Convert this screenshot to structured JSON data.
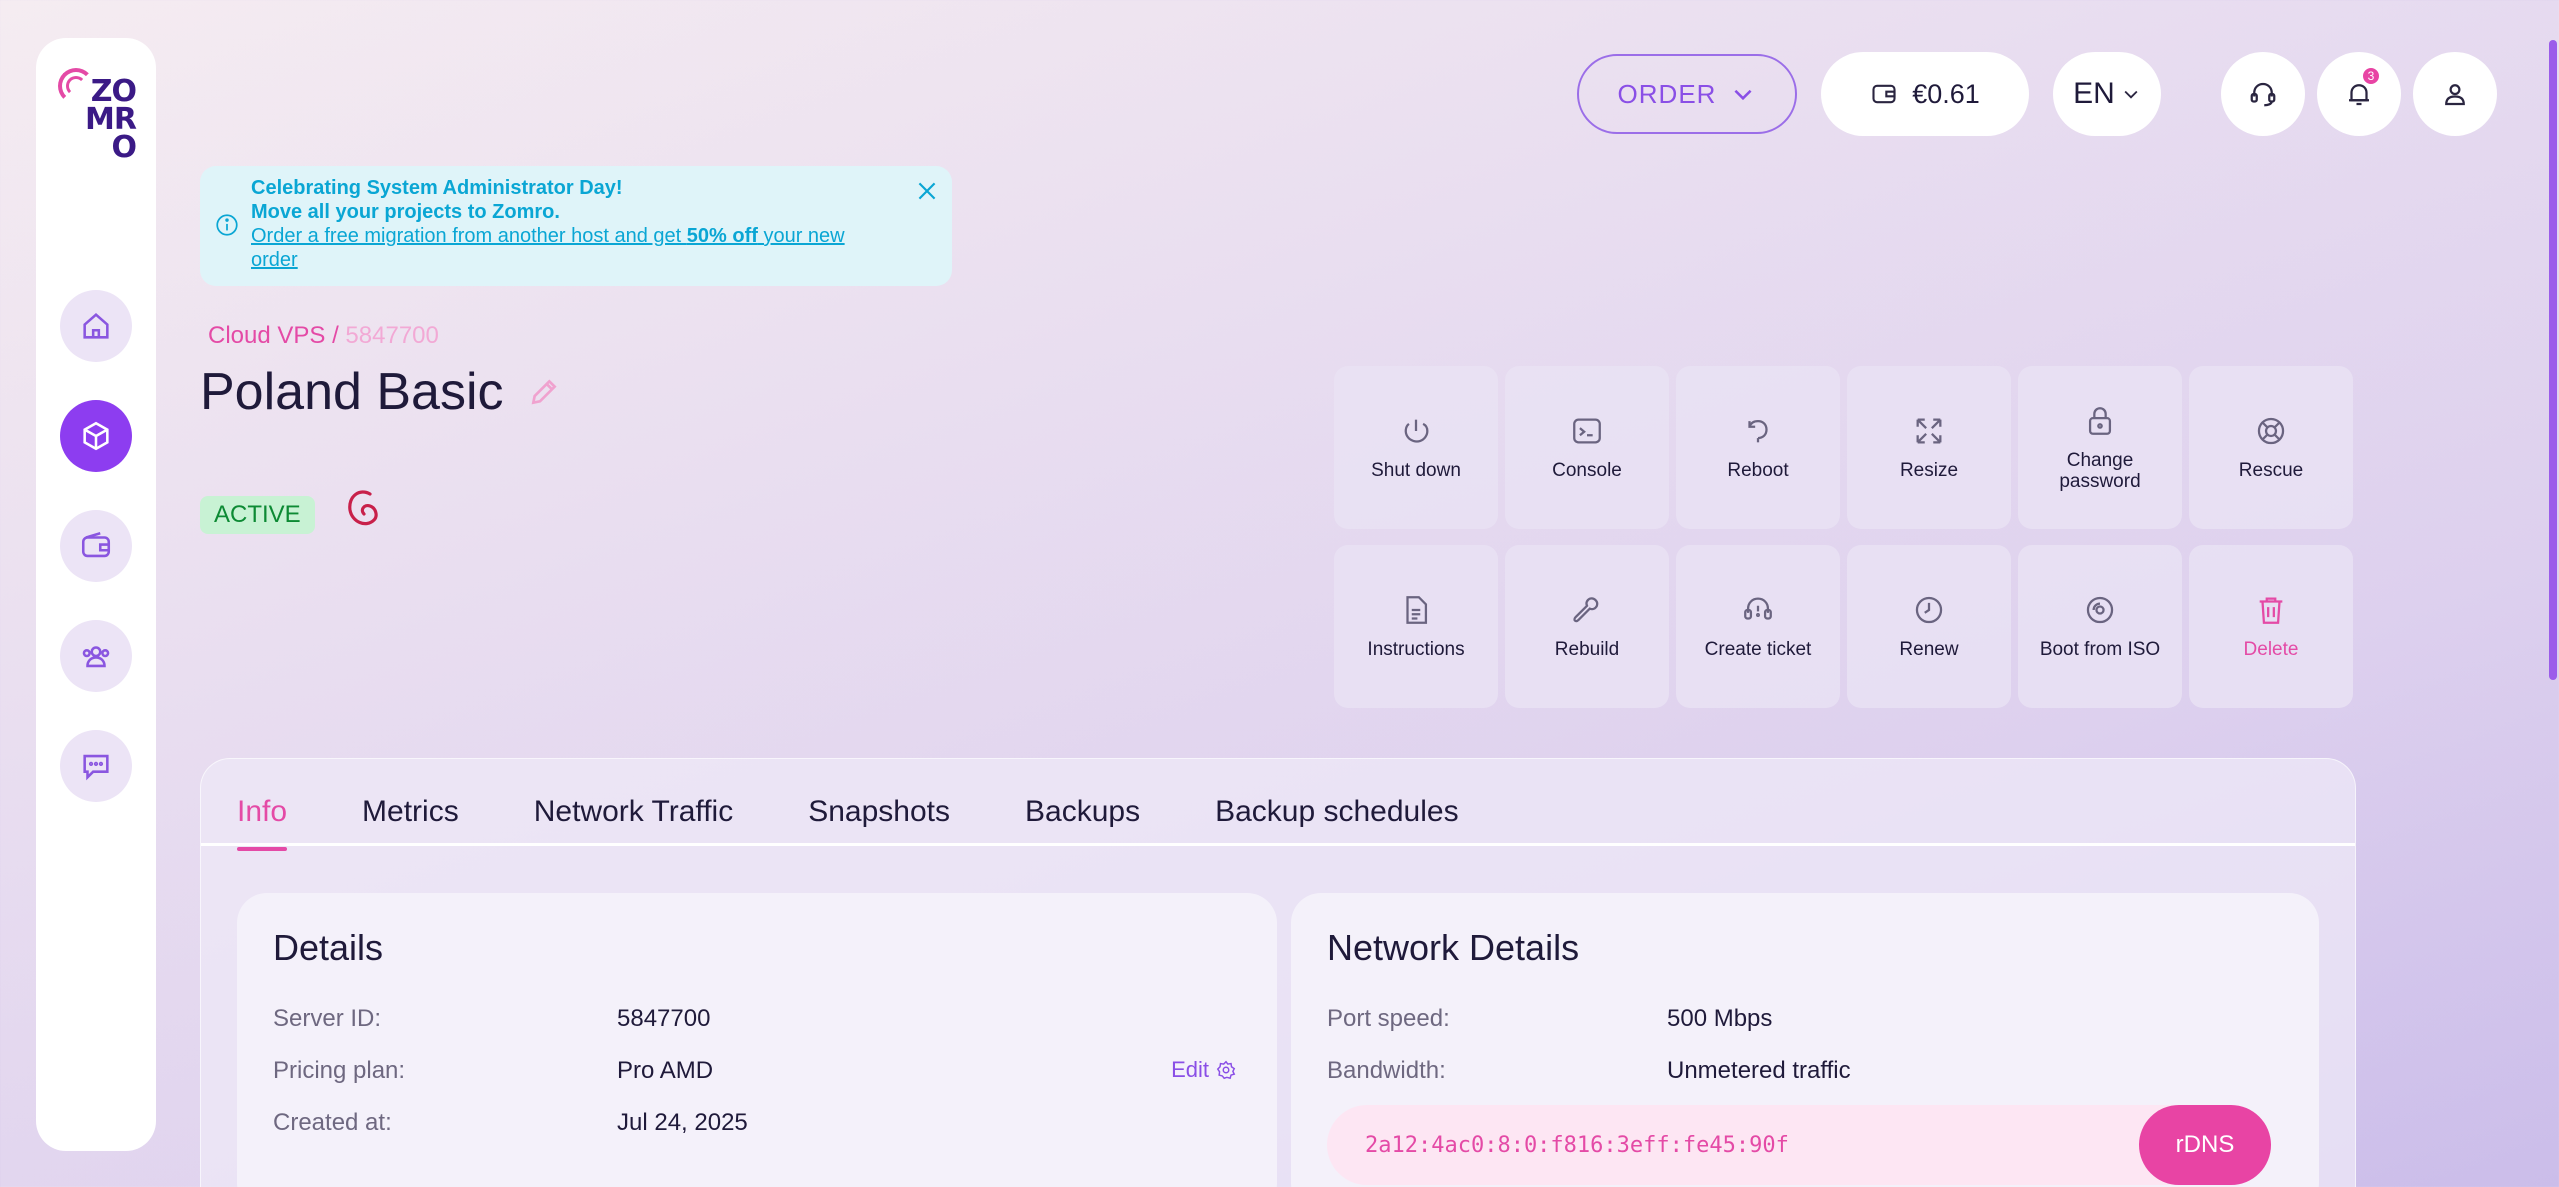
{
  "brand": {
    "logo_lines": [
      "ZO",
      "MR",
      "O"
    ]
  },
  "topbar": {
    "order_label": "ORDER",
    "balance": "€0.61",
    "language": "EN",
    "notifications_count": "3"
  },
  "banner": {
    "line1": "Celebrating System Administrator Day!",
    "line2": "Move all your projects to Zomro.",
    "link_pre": "Order a free migration from another host and get ",
    "link_bold": "50% off",
    "link_post": " your new order"
  },
  "breadcrumb": {
    "section": "Cloud VPS",
    "separator": " / ",
    "id": "5847700"
  },
  "server": {
    "title": "Poland Basic",
    "status": "ACTIVE",
    "os": "debian-icon"
  },
  "actions": [
    {
      "label": "Shut down",
      "icon": "power-icon"
    },
    {
      "label": "Console",
      "icon": "terminal-icon"
    },
    {
      "label": "Reboot",
      "icon": "reboot-icon"
    },
    {
      "label": "Resize",
      "icon": "resize-icon"
    },
    {
      "label": "Change password",
      "icon": "lock-icon"
    },
    {
      "label": "Rescue",
      "icon": "lifebuoy-icon"
    },
    {
      "label": "Instructions",
      "icon": "document-icon"
    },
    {
      "label": "Rebuild",
      "icon": "wrench-icon"
    },
    {
      "label": "Create ticket",
      "icon": "headset-icon"
    },
    {
      "label": "Renew",
      "icon": "clock-icon"
    },
    {
      "label": "Boot from ISO",
      "icon": "disc-icon"
    },
    {
      "label": "Delete",
      "icon": "trash-icon"
    }
  ],
  "tabs": [
    "Info",
    "Metrics",
    "Network Traffic",
    "Snapshots",
    "Backups",
    "Backup schedules"
  ],
  "details": {
    "title": "Details",
    "rows": [
      {
        "k": "Server ID:",
        "v": "5847700"
      },
      {
        "k": "Pricing plan:",
        "v": "Pro AMD"
      },
      {
        "k": "Created at:",
        "v": "Jul 24, 2025"
      }
    ],
    "edit_label": "Edit"
  },
  "network": {
    "title": "Network Details",
    "rows": [
      {
        "k": "Port speed:",
        "v": "500 Mbps"
      },
      {
        "k": "Bandwidth:",
        "v": "Unmetered traffic"
      }
    ],
    "ip": "2a12:4ac0:8:0:f816:3eff:fe45:90f",
    "rdns_label": "rDNS"
  },
  "colors": {
    "accent": "#8d3df0",
    "pink": "#e44aa6",
    "info": "#0aa6d4",
    "active_bg": "#c8f2d4"
  }
}
